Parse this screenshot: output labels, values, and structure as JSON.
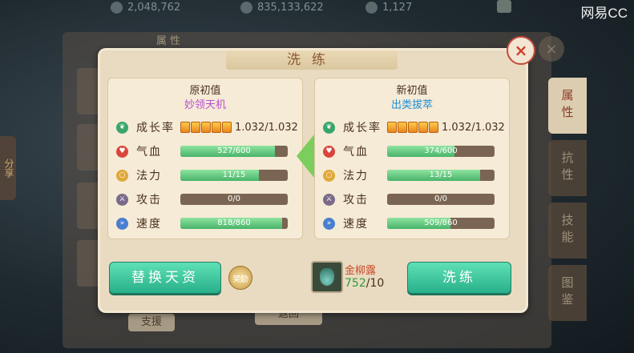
{
  "top_bar": {
    "currency_1": "2,048,762",
    "currency_2": "835,133,622",
    "currency_3": "1,127",
    "brand": "网易CC"
  },
  "background": {
    "panel_title": "属 性",
    "left_tab": "分享",
    "support_button": "支援",
    "return_button": "返回"
  },
  "right_tabs": [
    {
      "label": "属性",
      "active": true
    },
    {
      "label": "抗性",
      "active": false
    },
    {
      "label": "技能",
      "active": false
    },
    {
      "label": "图鉴",
      "active": false
    }
  ],
  "dialog": {
    "title": "洗练",
    "close_icon": "×",
    "original": {
      "title": "原初值",
      "talent": "妙领天机",
      "talent_color": "#b94fd0",
      "growth": "1.032/1.032",
      "stats": [
        {
          "label": "气血",
          "text": "527/600",
          "value": 527,
          "max": 600
        },
        {
          "label": "法力",
          "text": "11/15",
          "value": 11,
          "max": 15
        },
        {
          "label": "攻击",
          "text": "0/0",
          "value": 0,
          "max": 0
        },
        {
          "label": "速度",
          "text": "818/860",
          "value": 818,
          "max": 860
        }
      ]
    },
    "new": {
      "title": "新初值",
      "talent": "出类拔萃",
      "talent_color": "#1f8fd6",
      "growth": "1.032/1.032",
      "stats": [
        {
          "label": "气血",
          "text": "374/600",
          "value": 374,
          "max": 600
        },
        {
          "label": "法力",
          "text": "13/15",
          "value": 13,
          "max": 15
        },
        {
          "label": "攻击",
          "text": "0/0",
          "value": 0,
          "max": 0
        },
        {
          "label": "速度",
          "text": "509/860",
          "value": 509,
          "max": 860
        }
      ]
    },
    "growth_label": "成长率",
    "replace_button": "替换天资",
    "coin_badge": "奖励",
    "item": {
      "name": "金柳露",
      "count": "752",
      "count_suffix": "/10"
    },
    "refine_button": "洗练"
  },
  "colors": {
    "accent_green": "#2fb98f",
    "item_count": "#2e9d3e",
    "close_red": "#d23c2c"
  }
}
